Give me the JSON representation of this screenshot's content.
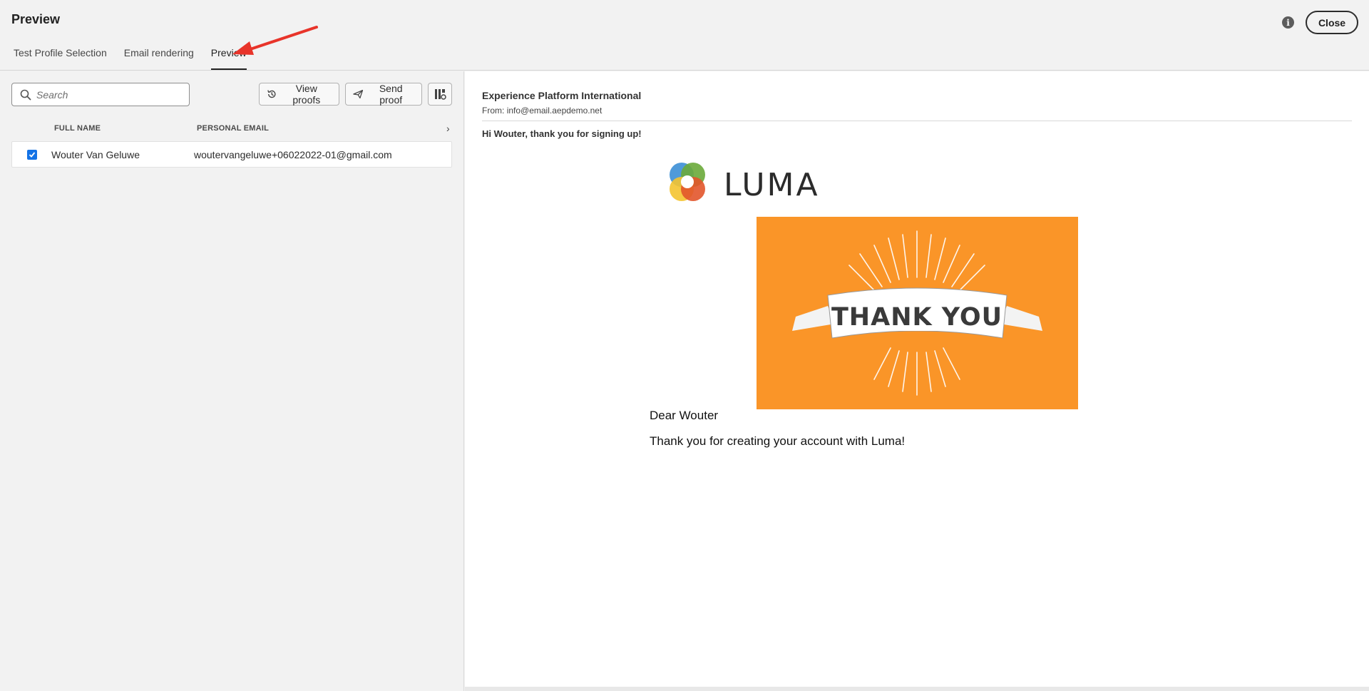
{
  "dialog": {
    "title": "Preview",
    "close_label": "Close",
    "info_icon": "info-icon"
  },
  "tabs": [
    {
      "label": "Test Profile Selection",
      "active": false
    },
    {
      "label": "Email rendering",
      "active": false
    },
    {
      "label": "Preview",
      "active": true
    }
  ],
  "left_pane": {
    "search_placeholder": "Search",
    "view_proofs_label": "View proofs",
    "send_proof_label": "Send proof",
    "columns": [
      "FULL NAME",
      "PERSONAL EMAIL"
    ],
    "rows": [
      {
        "checked": true,
        "full_name": "Wouter Van Geluwe",
        "email": "woutervangeluwe+06022022-01@gmail.com"
      }
    ]
  },
  "email": {
    "sender_name": "Experience Platform International",
    "from_label": "From:",
    "from_address": "info@email.aepdemo.net",
    "subject": "Hi Wouter, thank you for signing up!",
    "logo_text": "LUMA",
    "hero_text": "THANK YOU",
    "greeting": "Dear Wouter",
    "body": "Thank you for creating your account with Luma!"
  },
  "colors": {
    "accent": "#1473e6",
    "hero_bg": "#fa9528",
    "annotation_arrow": "#e8342a"
  }
}
